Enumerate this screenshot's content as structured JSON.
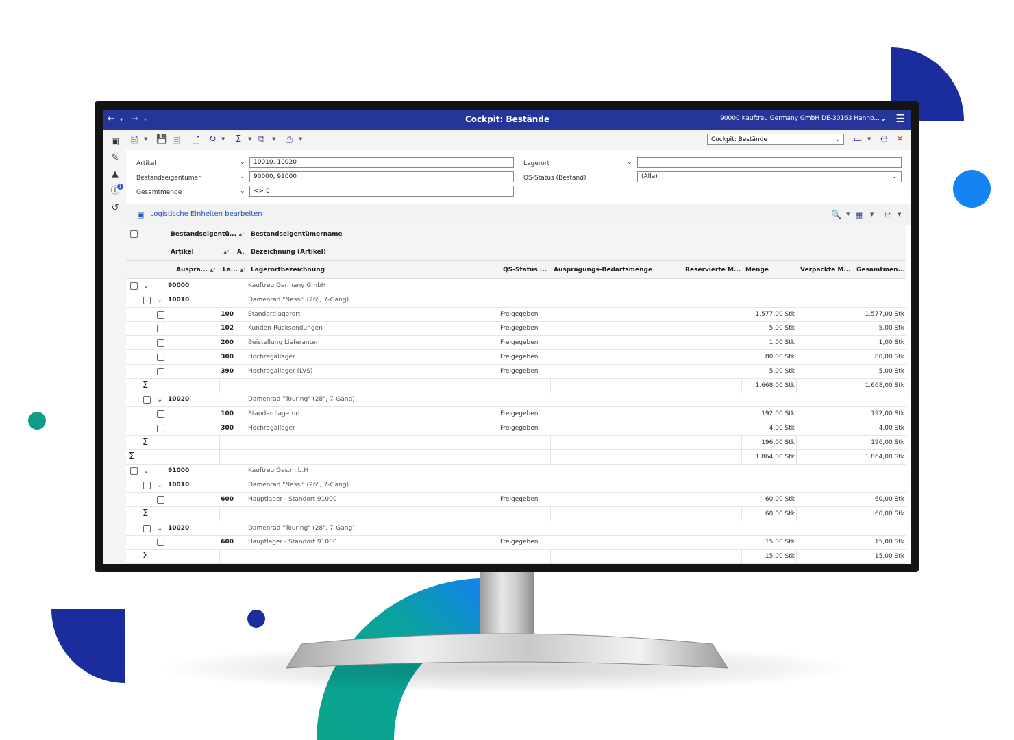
{
  "window": {
    "title": "Cockpit: Bestände",
    "company": "90000  Kauftreu Germany GmbH DE-30163 Hanno..."
  },
  "colors": {
    "titlebar": "#26359a",
    "accent_navy": "#1b2c9c",
    "accent_blue": "#1384f2",
    "accent_green": "#0e9d86",
    "link": "#2a52be"
  },
  "nav_icons": [
    "arrow-left-icon",
    "arrow-right-icon",
    "chevron-down-icon",
    "menu-icon"
  ],
  "toolbar": {
    "view_select": "Cockpit: Bestände",
    "icons": [
      "new-document-icon",
      "save-icon",
      "discard-icon",
      "copy-icon",
      "refresh-icon",
      "sum-icon",
      "export-icon",
      "print-icon",
      "window-icon",
      "text-format-icon",
      "close-icon"
    ]
  },
  "filters": {
    "artikel": {
      "label": "Artikel",
      "value": "10010, 10020"
    },
    "bestandseigentuemer": {
      "label": "Bestandseigentümer",
      "value": "90000, 91000"
    },
    "gesamtmenge": {
      "label": "Gesamtmenge",
      "value": "<> 0"
    },
    "lagerort": {
      "label": "Lagerort",
      "value": ""
    },
    "qs_status": {
      "label": "QS-Status (Bestand)",
      "value": "(Alle)"
    }
  },
  "section": {
    "link": "Logistische Einheiten bearbeiten"
  },
  "table": {
    "headers": {
      "row1": [
        "Bestandseigentü...",
        "Bestandseigentümername"
      ],
      "row2": [
        "Artikel",
        "A.",
        "Bezeichnung (Artikel)"
      ],
      "row3": [
        "Ausprä...",
        "La...",
        "Lagerortbezeichnung",
        "QS-Status ...",
        "Ausprägungs-Bedarfsmenge",
        "Reservierte M...",
        "Menge",
        "Verpackte M...",
        "Gesamtmen..."
      ]
    },
    "rows": [
      {
        "type": "owner",
        "code": "90000",
        "name": "Kauftreu Germany GmbH"
      },
      {
        "type": "article",
        "code": "10010",
        "name": "Damenrad \"Nessi\" (26\", 7-Gang)"
      },
      {
        "type": "detail",
        "lager": "100",
        "bez": "Standardlagerort",
        "qs": "Freigegeben",
        "menge": "1.577,00 Stk",
        "gesamt": "1.577,00 Stk"
      },
      {
        "type": "detail",
        "lager": "102",
        "bez": "Kunden-Rücksendungen",
        "qs": "Freigegeben",
        "menge": "5,00 Stk",
        "gesamt": "5,00 Stk"
      },
      {
        "type": "detail",
        "lager": "200",
        "bez": "Beistellung Lieferanten",
        "qs": "Freigegeben",
        "menge": "1,00 Stk",
        "gesamt": "1,00 Stk"
      },
      {
        "type": "detail",
        "lager": "300",
        "bez": "Hochregallager",
        "qs": "Freigegeben",
        "menge": "80,00 Stk",
        "gesamt": "80,00 Stk"
      },
      {
        "type": "detail",
        "lager": "390",
        "bez": "Hochregallager (LVS)",
        "qs": "Freigegeben",
        "menge": "5,00 Stk",
        "gesamt": "5,00 Stk"
      },
      {
        "type": "sum",
        "level": 2,
        "menge": "1.668,00 Stk",
        "gesamt": "1.668,00 Stk"
      },
      {
        "type": "article",
        "code": "10020",
        "name": "Damenrad \"Touring\" (28\", 7-Gang)"
      },
      {
        "type": "detail",
        "lager": "100",
        "bez": "Standardlagerort",
        "qs": "Freigegeben",
        "menge": "192,00 Stk",
        "gesamt": "192,00 Stk"
      },
      {
        "type": "detail",
        "lager": "300",
        "bez": "Hochregallager",
        "qs": "Freigegeben",
        "menge": "4,00 Stk",
        "gesamt": "4,00 Stk"
      },
      {
        "type": "sum",
        "level": 2,
        "menge": "196,00 Stk",
        "gesamt": "196,00 Stk"
      },
      {
        "type": "sum",
        "level": 1,
        "menge": "1.864,00 Stk",
        "gesamt": "1.864,00 Stk"
      },
      {
        "type": "owner",
        "code": "91000",
        "name": "Kauftreu Ges.m.b.H"
      },
      {
        "type": "article",
        "code": "10010",
        "name": "Damenrad \"Nessi\" (26\", 7-Gang)"
      },
      {
        "type": "detail",
        "lager": "600",
        "bez": "Hauptlager - Standort 91000",
        "qs": "Freigegeben",
        "menge": "60,00 Stk",
        "gesamt": "60,00 Stk"
      },
      {
        "type": "sum",
        "level": 2,
        "menge": "60,00 Stk",
        "gesamt": "60,00 Stk"
      },
      {
        "type": "article",
        "code": "10020",
        "name": "Damenrad \"Touring\" (28\", 7-Gang)"
      },
      {
        "type": "detail",
        "lager": "600",
        "bez": "Hauptlager - Standort 91000",
        "qs": "Freigegeben",
        "menge": "15,00 Stk",
        "gesamt": "15,00 Stk"
      },
      {
        "type": "sum",
        "level": 2,
        "menge": "15,00 Stk",
        "gesamt": "15,00 Stk"
      }
    ]
  }
}
